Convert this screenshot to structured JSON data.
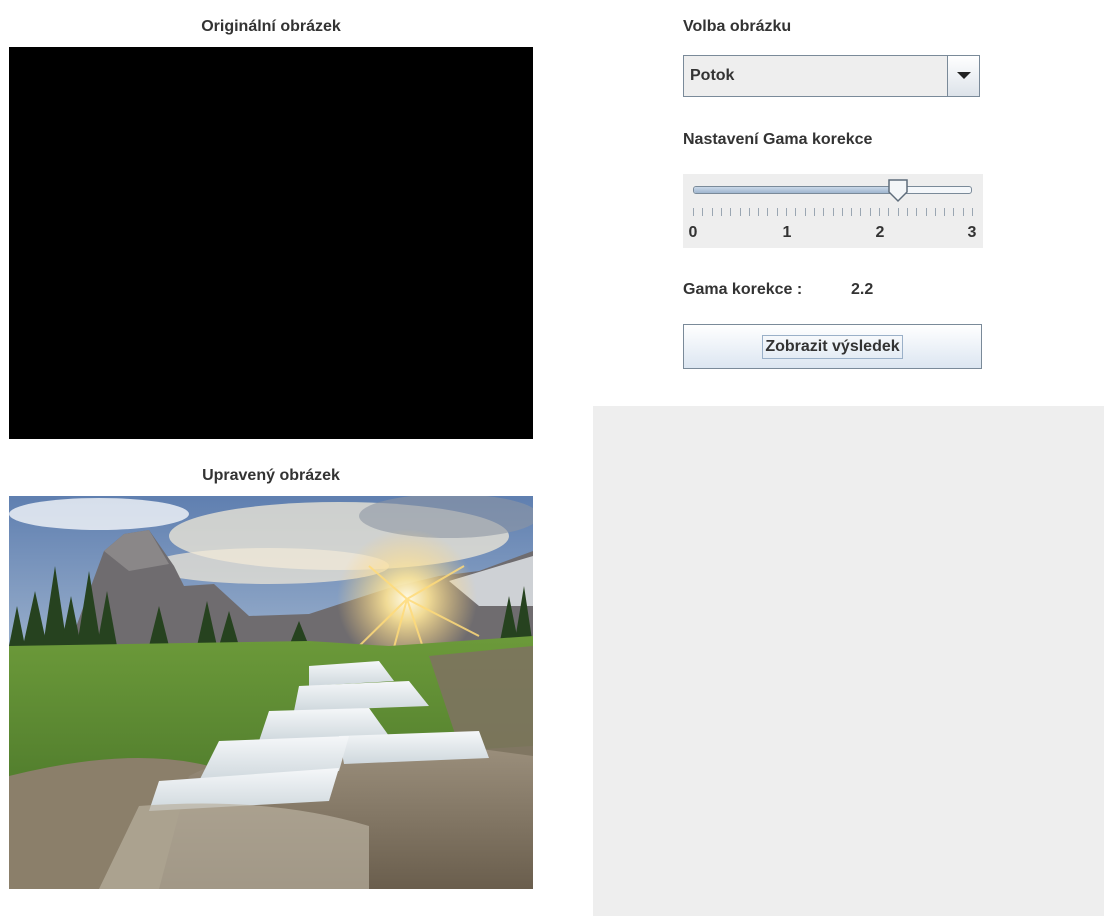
{
  "original": {
    "caption": "Originální obrázek"
  },
  "edited": {
    "caption": "Upravený obrázek"
  },
  "controls": {
    "image_choice_label": "Volba obrázku",
    "image_choice_value": "Potok",
    "gamma_setting_label": "Nastavení Gama korekce",
    "slider": {
      "min": 0,
      "max": 3,
      "value": 2.2,
      "major_labels": [
        "0",
        "1",
        "2",
        "3"
      ]
    },
    "gamma_value_label": "Gama korekce :",
    "gamma_value": "2.2",
    "show_result_label": "Zobrazit výsledek"
  },
  "colors": {
    "panel_gray": "#eeeeee",
    "border": "#7a8a99",
    "text": "#333333"
  }
}
